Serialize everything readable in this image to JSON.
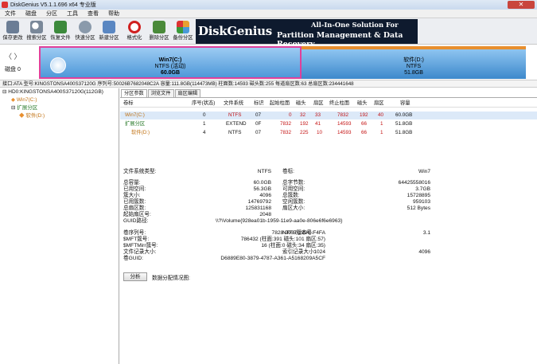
{
  "window": {
    "title": "DiskGenius V5.1.1.696 x64 专业版",
    "close": "✕"
  },
  "menu": [
    "文件",
    "磁盘",
    "分区",
    "工具",
    "查看",
    "帮助"
  ],
  "toolbar": [
    {
      "label": "保存更改",
      "icon": "save-icon",
      "color": "#6b7d95"
    },
    {
      "label": "搜索分区",
      "icon": "search-icon",
      "color": "#7a8899"
    },
    {
      "label": "恢复文件",
      "icon": "recover-icon",
      "color": "#3c8a3c"
    },
    {
      "label": "快速分区",
      "icon": "quick-partition-icon",
      "color": "#8a9aab"
    },
    {
      "label": "新建分区",
      "icon": "new-partition-icon",
      "color": "#5a87c2"
    },
    {
      "label": "格式化",
      "icon": "format-icon",
      "color": "#d02020"
    },
    {
      "label": "删除分区",
      "icon": "delete-icon",
      "color": "#4a8a3a"
    },
    {
      "label": "备份分区",
      "icon": "backup-icon",
      "color": "#e8a030"
    }
  ],
  "banner": {
    "logo": "DiskGenius",
    "tagline1": "All-In-One Solution For",
    "tagline2": "Partition Management & Data Recovery"
  },
  "disk_map": {
    "nav": "〈 〉",
    "disk_label": "磁盘 0",
    "p1": {
      "name": "Win7(C:)",
      "fs": "NTFS (活动)",
      "size": "60.0GB"
    },
    "p2": {
      "name": "软件(D:)",
      "fs": "NTFS",
      "size": "51.8GB"
    }
  },
  "infobar": "接口:ATA 型号:KINGSTONSA400S37120G 序列号:50026B7682048C2A 容量:111.8GB(114473MB) 柱面数:14593 磁头数:255 每道扇区数:63 总扇区数:234441648",
  "tree": {
    "disk": "HD0:KINGSTONSA400S37120G(112GB)",
    "p1": "Win7(C:)",
    "ext": "扩展分区",
    "p2": "软件(D:)"
  },
  "tabs": [
    "分区参数",
    "浏览文件",
    "扇区编辑"
  ],
  "table": {
    "headers": [
      "卷标",
      "序号(状态)",
      "文件系统",
      "标识",
      "起始柱面",
      "磁头",
      "扇区",
      "终止柱面",
      "磁头",
      "扇区",
      "容量"
    ],
    "rows": [
      {
        "name": "Win7(C:)",
        "seq": "0",
        "fs": "NTFS",
        "id": "07",
        "sc": "0",
        "sh": "32",
        "ss": "33",
        "ec": "7832",
        "eh": "192",
        "es": "40",
        "cap": "60.0GB"
      },
      {
        "name": "扩展分区",
        "seq": "1",
        "fs": "EXTEND",
        "id": "0F",
        "sc": "7832",
        "sh": "192",
        "ss": "41",
        "ec": "14593",
        "eh": "66",
        "es": "1",
        "cap": "51.8GB"
      },
      {
        "name": "软件(D:)",
        "seq": "4",
        "fs": "NTFS",
        "id": "07",
        "sc": "7832",
        "sh": "225",
        "ss": "10",
        "ec": "14593",
        "eh": "66",
        "es": "1",
        "cap": "51.8GB"
      }
    ]
  },
  "details_left": [
    {
      "label": "文件系统类型:",
      "value": "NTFS"
    },
    {
      "label": "总容量:",
      "value": "60.0GB"
    },
    {
      "label": "已用空间:",
      "value": "56.3GB"
    },
    {
      "label": "簇大小:",
      "value": "4096"
    },
    {
      "label": "已用簇数:",
      "value": "14769792"
    },
    {
      "label": "总扇区数:",
      "value": "125831168"
    },
    {
      "label": "起始扇区号:",
      "value": "2048"
    }
  ],
  "details_right": [
    {
      "label": "卷标:",
      "value": "Win7"
    },
    {
      "label": "总字节数:",
      "value": "64425558016"
    },
    {
      "label": "可用空间:",
      "value": "3.7GB"
    },
    {
      "label": "总簇数:",
      "value": "15728895"
    },
    {
      "label": "空闲簇数:",
      "value": "959103"
    },
    {
      "label": "扇区大小:",
      "value": "512 Bytes"
    }
  ],
  "guid_path": {
    "label": "GUID路径:",
    "value": "\\\\?\\Volume{928ea01b-1959-11e9-aa0e-806e6f6e6963}"
  },
  "ntfs_left": [
    {
      "label": "卷序列号:",
      "value": "7828-9037-289C-F4FA"
    },
    {
      "label": "$MFT簇号:",
      "value": "786432 (柱面:391 磁头:101 扇区:57)"
    },
    {
      "label": "$MFTMirr簇号:",
      "value": "16 (柱面:0 磁头:34 扇区:35)"
    },
    {
      "label": "文件记录大小:",
      "value": "1024"
    },
    {
      "label": "卷GUID:",
      "value": "D6889E80-3879-4787-A361-A5168209A5CF"
    }
  ],
  "ntfs_right": [
    {
      "label": "NTFS版本号:",
      "value": "3.1"
    },
    {
      "label": "",
      "value": ""
    },
    {
      "label": "",
      "value": ""
    },
    {
      "label": "索引记录大小:",
      "value": "4096"
    }
  ],
  "analyze": {
    "button": "分析",
    "label": "数据分配情况图:"
  }
}
